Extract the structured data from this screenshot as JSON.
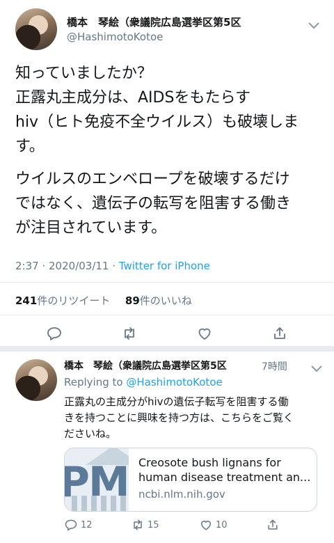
{
  "main_tweet": {
    "name": "橋本　琴絵（衆議院広島選挙区第5区",
    "handle": "@HashimotoKotoe",
    "body_lines": [
      "知っていましたか？",
      "正露丸主成分は、AIDSをもたらす",
      "hiv（ヒト免疫不全ウイルス）も破壊しま",
      "す。",
      "ウイルスのエンベロープを破壊するだけ",
      "ではなく、遺伝子の転写を阻害する働き",
      "が注目されています。"
    ],
    "time": "2:37",
    "date": "2020/03/11",
    "source": "Twitter for iPhone",
    "retweets_count": "241",
    "retweets_label": "件のリツイート",
    "likes_count": "89",
    "likes_label": "件のいいね",
    "actions": [
      "reply-icon",
      "retweet-icon",
      "like-icon",
      "share-icon"
    ]
  },
  "reply_tweet": {
    "name": "橋本　琴絵（衆議院広島選挙区第5区",
    "age": "7時間",
    "replying_prefix": "Replying to",
    "replying_handle": "@HashimotoKotoe",
    "body_lines": [
      "正露丸の主成分がhivの遺伝子転写を阻害する働",
      "きを持つことに興味を持つ方は、こちらをご覧く",
      "ださいね。"
    ],
    "card": {
      "image_text": "PMC",
      "title_lines": [
        "Creosote bush lignans for",
        "human disease treatment an..."
      ],
      "domain": "ncbi.nlm.nih.gov"
    },
    "reply_count": "12",
    "retweet_count": "15",
    "like_count": "10"
  },
  "colors": {
    "accent": "#1da1f2",
    "text": "#14171a",
    "secondary": "#657786",
    "divider": "#e6ecf0"
  }
}
